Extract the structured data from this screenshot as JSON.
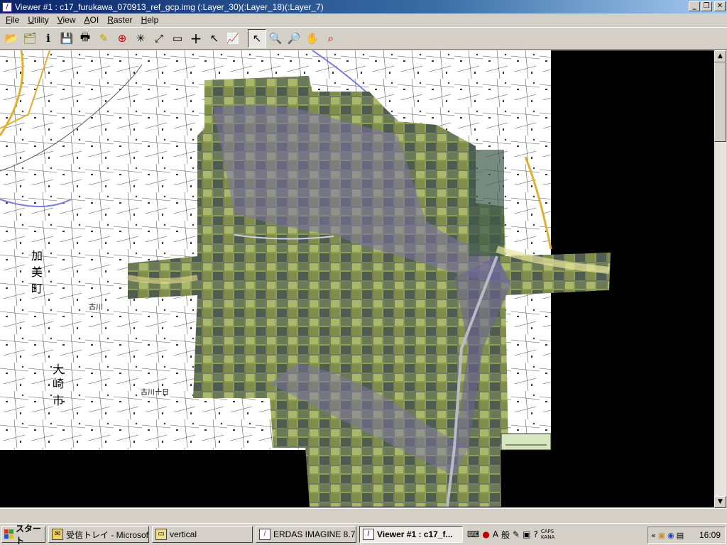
{
  "window": {
    "title": "Viewer #1 : c17_furukawa_070913_ref_gcp.img (:Layer_30)(:Layer_18)(:Layer_7)",
    "minimize_icon": "minimize-icon",
    "maximize_icon": "restore-icon",
    "close_icon": "close-icon"
  },
  "menu": {
    "items": [
      "File",
      "Utility",
      "View",
      "AOI",
      "Raster",
      "Help"
    ]
  },
  "toolbar": {
    "tools": [
      {
        "name": "open-icon",
        "glyph": "📂"
      },
      {
        "name": "open-layer-icon",
        "glyph": "🗂"
      },
      {
        "name": "info-icon",
        "glyph": "ℹ"
      },
      {
        "name": "save-icon",
        "glyph": "💾"
      },
      {
        "name": "print-icon",
        "glyph": "🖶"
      },
      {
        "name": "clear-icon",
        "glyph": "✎"
      },
      {
        "name": "cursor-position-icon",
        "glyph": "⊕"
      },
      {
        "name": "zoom-extent-icon",
        "glyph": "✳"
      },
      {
        "name": "fit-window-icon",
        "glyph": "⤢"
      },
      {
        "name": "measure-icon",
        "glyph": "▭"
      },
      {
        "name": "inquire-cursor-icon",
        "glyph": "+"
      },
      {
        "name": "annotation-icon",
        "glyph": "↖"
      },
      {
        "name": "profile-icon",
        "glyph": "📈"
      },
      {
        "name": "select-arrow-icon",
        "glyph": "↖"
      },
      {
        "name": "zoom-in-icon",
        "glyph": "🔍"
      },
      {
        "name": "zoom-out-icon",
        "glyph": "🔎"
      },
      {
        "name": "pan-hand-icon",
        "glyph": "✋"
      },
      {
        "name": "inquire-zoom-icon",
        "glyph": "⌕"
      }
    ]
  },
  "map": {
    "labels": [
      "加",
      "美",
      "町",
      "大",
      "崎",
      "市",
      "古川",
      "古川十日"
    ],
    "colors": {
      "background": "#000000",
      "topomap": "#ffffff",
      "imagery": "#8a9a4e",
      "road": "#e0b030",
      "water": "#7a7ae0"
    }
  },
  "taskbar": {
    "start_label": "スタート",
    "tasks": [
      {
        "name": "task-mail",
        "label": "受信トレイ - Microsoft ...",
        "icon": "mail-icon"
      },
      {
        "name": "task-folder",
        "label": "vertical",
        "icon": "folder-icon"
      },
      {
        "name": "task-erdas",
        "label": "ERDAS IMAGINE 8.7",
        "icon": "erdas-icon"
      },
      {
        "name": "task-viewer",
        "label": "Viewer #1 : c17_f...",
        "icon": "viewer-icon",
        "active": true
      }
    ],
    "ime": {
      "mode": "A",
      "kanji": "般",
      "caps": "CAPS",
      "kana": "KANA"
    },
    "clock": "16:09"
  }
}
